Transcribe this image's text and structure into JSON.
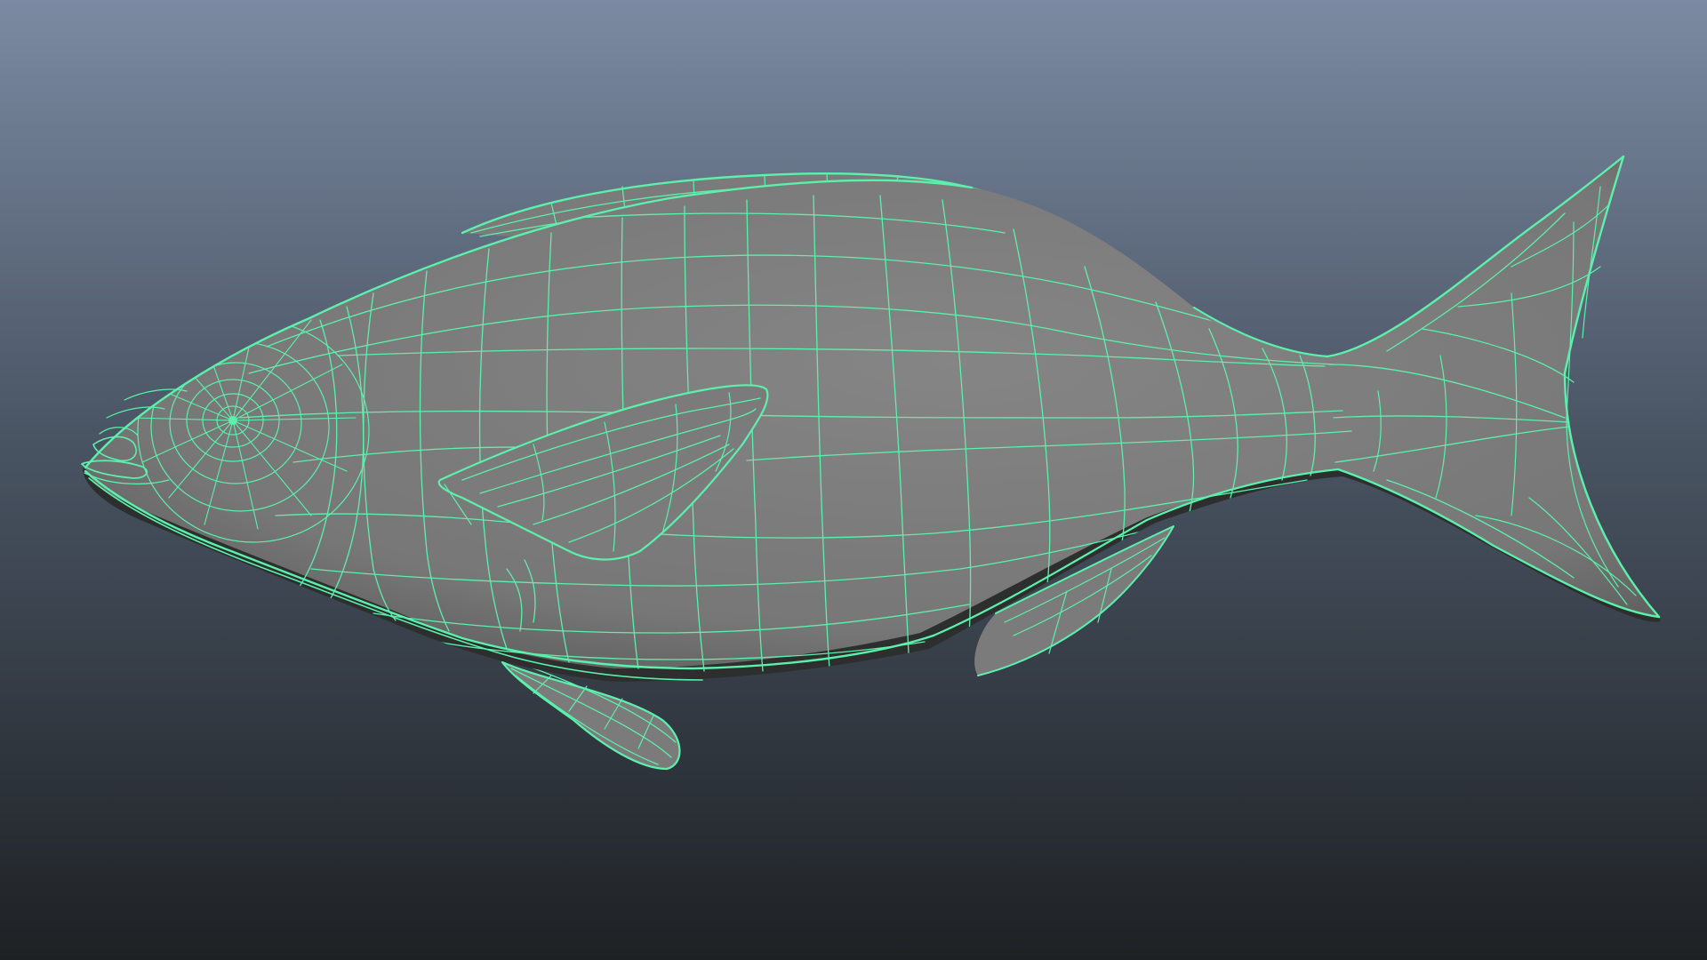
{
  "viewport": {
    "background_top": "#7b8aa2",
    "background_mid": "#4a5564",
    "background_bottom": "#1e2124"
  },
  "model": {
    "object": "fish-mesh",
    "display_mode": "wireframe-on-shaded",
    "surface_color": "#7b7b7b",
    "surface_shadow": "#2d2f2f",
    "wireframe_color": "#5cf0ac",
    "selected": true
  }
}
